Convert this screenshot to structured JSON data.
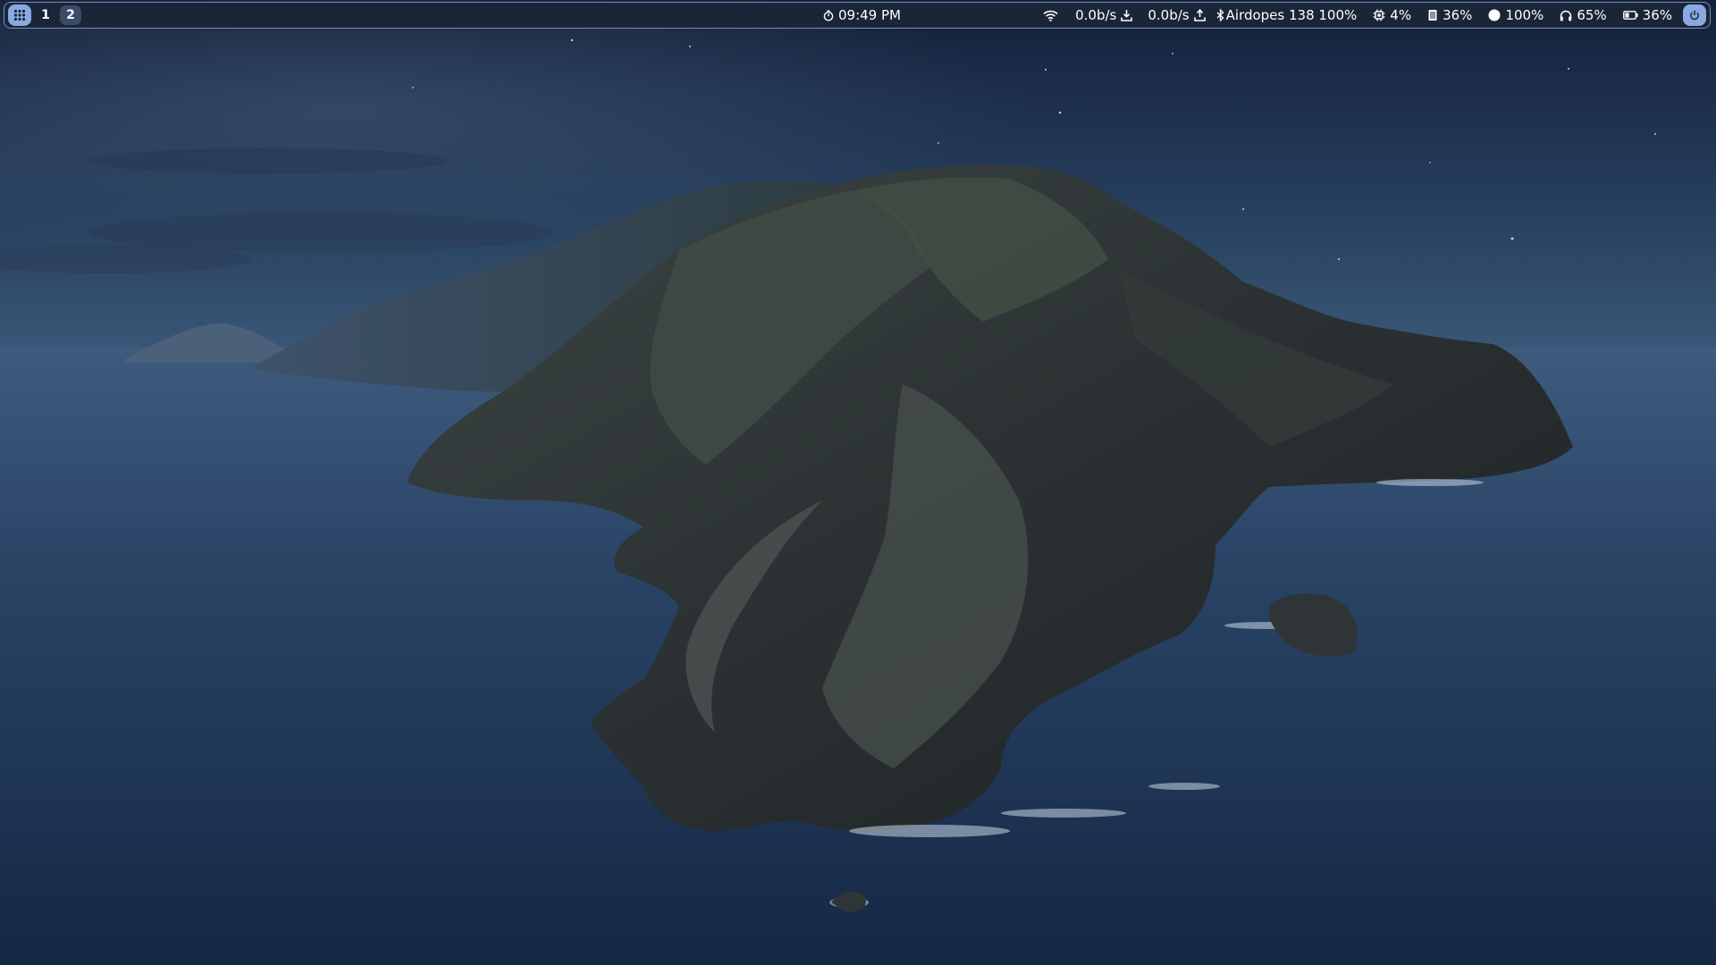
{
  "topbar": {
    "launcher_icon": "grid-icon",
    "workspaces": [
      {
        "label": "1",
        "active": false
      },
      {
        "label": "2",
        "active": true
      }
    ],
    "clock": {
      "icon": "timer-icon",
      "time": "09:49 PM"
    },
    "network": {
      "icon": "wifi-icon",
      "download": "0.0b/s",
      "download_icon": "download-icon",
      "upload": "0.0b/s",
      "upload_icon": "upload-icon"
    },
    "bluetooth": {
      "icon": "bluetooth-icon",
      "text": "Airdopes 138 100%"
    },
    "cpu": {
      "icon": "cpu-icon",
      "value": "4%"
    },
    "memory": {
      "icon": "memory-icon",
      "value": "36%"
    },
    "brightness": {
      "icon": "brightness-icon",
      "value": "100%"
    },
    "volume": {
      "icon": "headphones-icon",
      "value": "65%"
    },
    "battery": {
      "icon": "battery-icon",
      "value": "36%"
    },
    "power_icon": "power-icon"
  },
  "colors": {
    "bar_bg": "#1b2538",
    "bar_border": "#7d8fb3",
    "accent": "#8aa9e0",
    "active_workspace": "#3b4a66",
    "text": "#ffffff"
  }
}
